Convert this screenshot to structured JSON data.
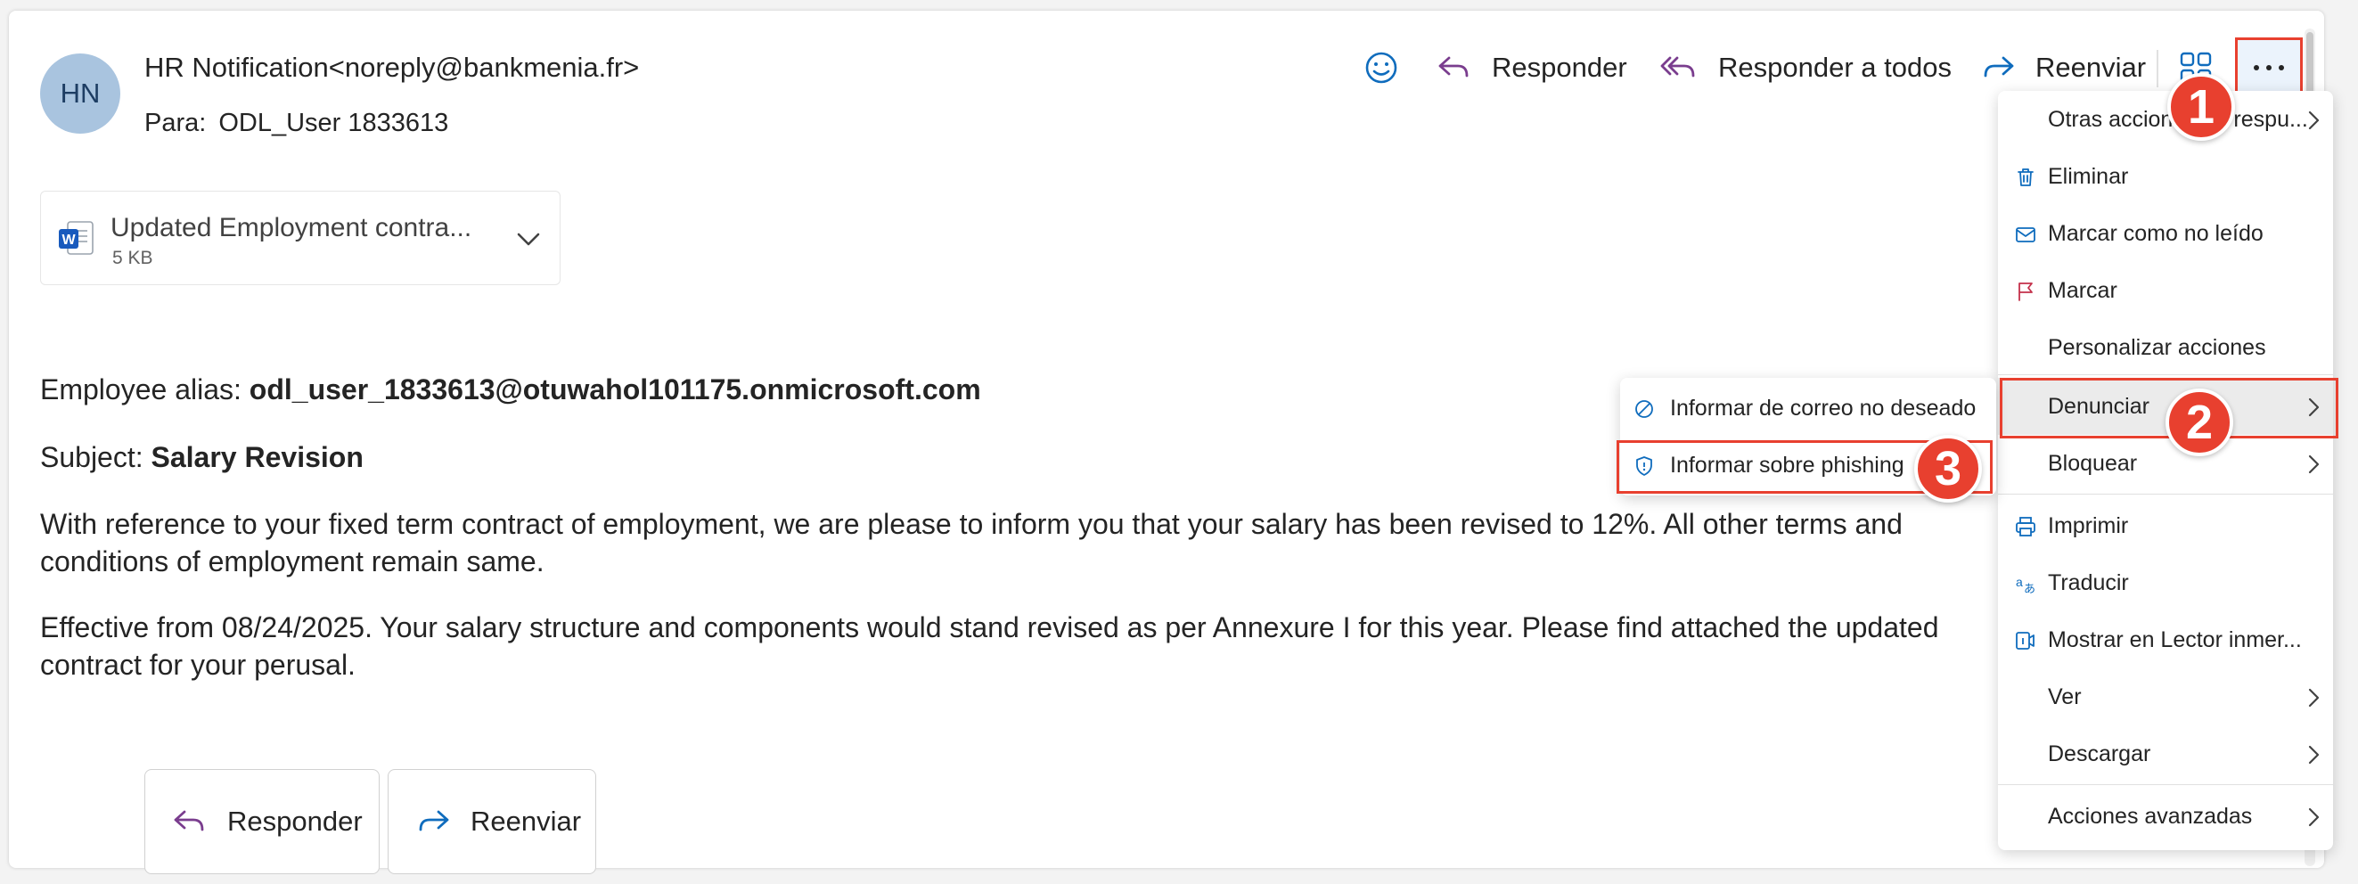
{
  "email": {
    "avatar_initials": "HN",
    "sender": "HR Notification<noreply@bankmenia.fr>",
    "to_label": "Para:",
    "to_value": "ODL_User 1833613"
  },
  "toolbar": {
    "reply_label": "Responder",
    "reply_all_label": "Responder a todos",
    "forward_label": "Reenviar"
  },
  "attachment": {
    "name": "Updated Employment contra...",
    "size": "5 KB",
    "icon": "word-doc-icon"
  },
  "body": {
    "alias_label": "Employee alias:",
    "alias_value": "odl_user_1833613@otuwahol101175.onmicrosoft.com",
    "subject_label": "Subject:",
    "subject_value": "Salary Revision",
    "paragraph1": "With reference to your fixed term contract of employment, we are please to inform you that your salary has been revised to 12%. All other terms and conditions of employment remain same.",
    "paragraph2": "Effective from 08/24/2025. Your salary structure and components would stand revised as per Annexure I for this year. Please find attached the updated contract for your perusal."
  },
  "bottom_actions": {
    "reply_label": "Responder",
    "forward_label": "Reenviar"
  },
  "menu": {
    "items": [
      {
        "label": "Otras acciones de respu...",
        "icon": "none",
        "submenu": true
      },
      {
        "label": "Eliminar",
        "icon": "trash-icon",
        "submenu": false
      },
      {
        "label": "Marcar como no leído",
        "icon": "mail-icon",
        "submenu": false
      },
      {
        "label": "Marcar",
        "icon": "flag-icon",
        "submenu": false
      },
      {
        "label": "Personalizar acciones",
        "icon": "none",
        "submenu": false
      },
      {
        "label": "Denunciar",
        "icon": "none",
        "submenu": true
      },
      {
        "label": "Bloquear",
        "icon": "none",
        "submenu": true
      },
      {
        "label": "Imprimir",
        "icon": "print-icon",
        "submenu": false
      },
      {
        "label": "Traducir",
        "icon": "translate-icon",
        "submenu": false
      },
      {
        "label": "Mostrar en Lector inmer...",
        "icon": "reader-icon",
        "submenu": false
      },
      {
        "label": "Ver",
        "icon": "none",
        "submenu": true
      },
      {
        "label": "Descargar",
        "icon": "none",
        "submenu": true
      },
      {
        "label": "Acciones avanzadas",
        "icon": "none",
        "submenu": true
      }
    ]
  },
  "submenu": {
    "items": [
      {
        "label": "Informar de correo no deseado",
        "icon": "block-icon"
      },
      {
        "label": "Informar sobre phishing",
        "icon": "shield-icon"
      }
    ]
  },
  "annotations": {
    "step1": "1",
    "step2": "2",
    "step3": "3"
  },
  "colors": {
    "highlight": "#e8402f",
    "accent": "#0f6cbd",
    "reply_purple": "#7a3d8e"
  }
}
